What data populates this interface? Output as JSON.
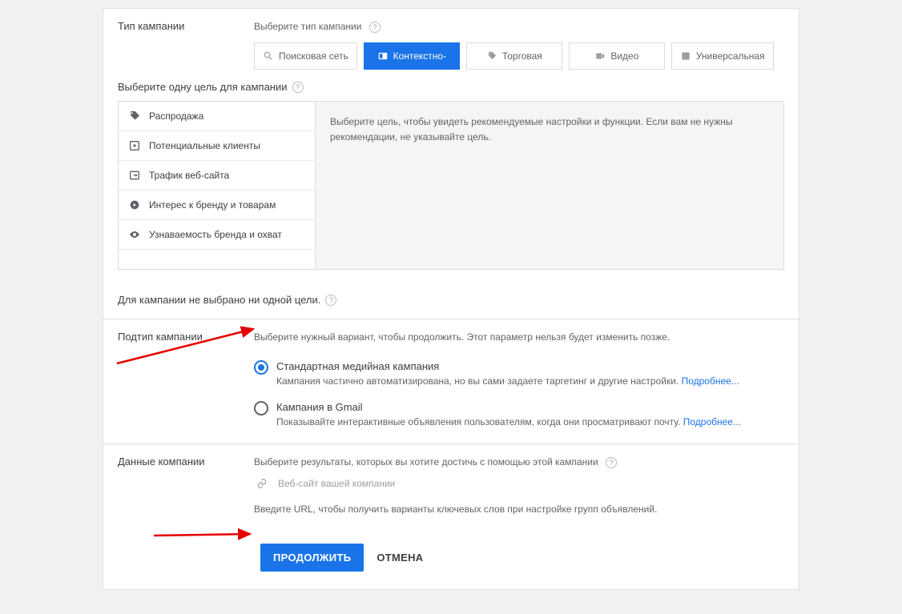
{
  "campaign_type": {
    "label": "Тип кампании",
    "prompt": "Выберите тип кампании",
    "tabs": {
      "search": "Поисковая сеть",
      "display": "Контекстно-",
      "shopping": "Торговая",
      "video": "Видео",
      "universal": "Универсальная"
    }
  },
  "goal": {
    "header": "Выберите одну цель для кампании",
    "items": {
      "sale": "Распродажа",
      "leads": "Потенциальные клиенты",
      "traffic": "Трафик веб-сайта",
      "interest": "Интерес к бренду и товарам",
      "awareness": "Узнаваемость бренда и охват"
    },
    "description": "Выберите цель, чтобы увидеть рекомендуемые настройки и функции. Если вам не нужны рекомендации, не указывайте цель.",
    "none_selected": "Для кампании не выбрано ни одной цели."
  },
  "subtype": {
    "label": "Подтип кампании",
    "prompt": "Выберите нужный вариант, чтобы продолжить. Этот параметр нельзя будет изменить позже.",
    "standard": {
      "title": "Стандартная медийная кампания",
      "desc": "Кампания частично автоматизирована, но вы сами задаете таргетинг и другие настройки. ",
      "more": "Подробнее..."
    },
    "gmail": {
      "title": "Кампания в Gmail",
      "desc": "Показывайте интерактивные объявления пользователям, когда они просматривают почту. ",
      "more": "Подробнее..."
    }
  },
  "company": {
    "label": "Данные компании",
    "prompt": "Выберите результаты, которых вы хотите достичь с помощью этой кампании",
    "website_placeholder": "Веб-сайт вашей компании",
    "url_hint": "Введите URL, чтобы получить варианты ключевых слов при настройке групп объявлений."
  },
  "buttons": {
    "continue": "ПРОДОЛЖИТЬ",
    "cancel": "ОТМЕНА"
  }
}
